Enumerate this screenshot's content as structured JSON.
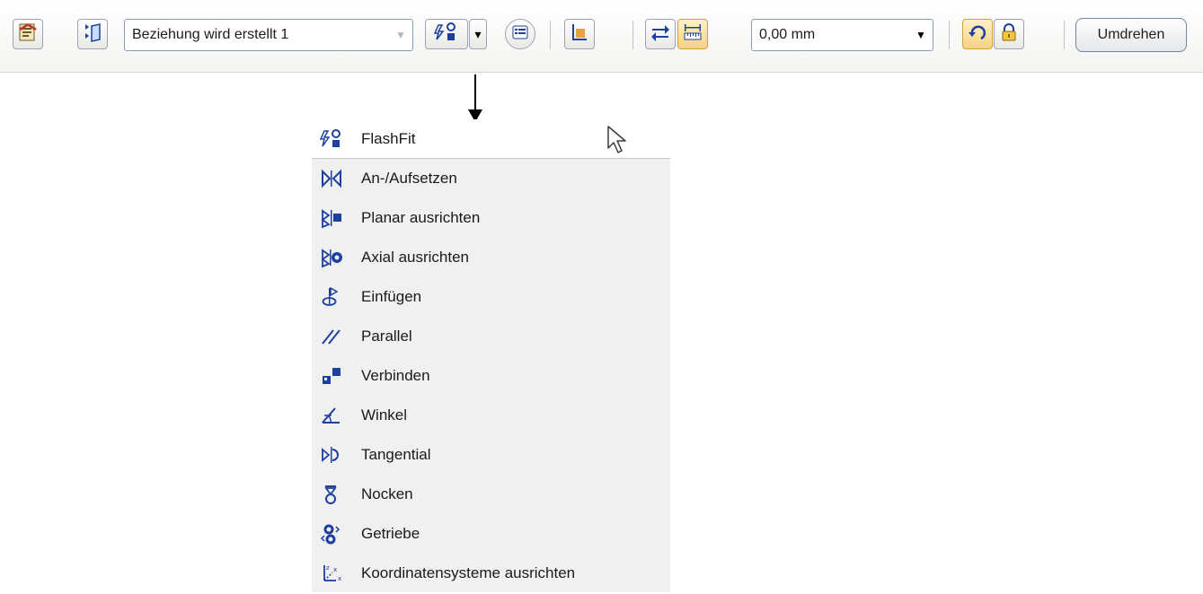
{
  "toolbar": {
    "relationship_combo": {
      "value": "Beziehung wird erstellt 1",
      "arrow": "▼"
    },
    "offset_combo": {
      "value": "0,00 mm",
      "arrow": "▼"
    },
    "split_arrow": "▾",
    "flip_label": "Umdrehen"
  },
  "icons": {
    "properties": "properties-icon",
    "select_parts": "parts-icon",
    "relationship_type": "flashfit-icon",
    "options": "options-icon",
    "fixed": "flag-icon",
    "swap": "swap-arrows-icon",
    "offset_type": "measure-icon",
    "rotate": "rotate-icon",
    "lock": "lock-icon"
  },
  "menu": {
    "items": [
      {
        "label": "FlashFit",
        "icon": "flashfit-icon"
      },
      {
        "label": "An-/Aufsetzen",
        "icon": "mate-icon"
      },
      {
        "label": "Planar ausrichten",
        "icon": "planar-align-icon"
      },
      {
        "label": "Axial ausrichten",
        "icon": "axial-align-icon"
      },
      {
        "label": "Einfügen",
        "icon": "insert-icon"
      },
      {
        "label": "Parallel",
        "icon": "parallel-icon"
      },
      {
        "label": "Verbinden",
        "icon": "connect-icon"
      },
      {
        "label": "Winkel",
        "icon": "angle-icon"
      },
      {
        "label": "Tangential",
        "icon": "tangent-icon"
      },
      {
        "label": "Nocken",
        "icon": "cam-icon"
      },
      {
        "label": "Getriebe",
        "icon": "gear-icon"
      },
      {
        "label": "Koordinatensysteme ausrichten",
        "icon": "coordinate-system-icon"
      }
    ]
  },
  "colors": {
    "icon_blue": "#1d3f9e",
    "accent_orange": "#e8a33a",
    "menu_bg": "#f0f0f0"
  }
}
